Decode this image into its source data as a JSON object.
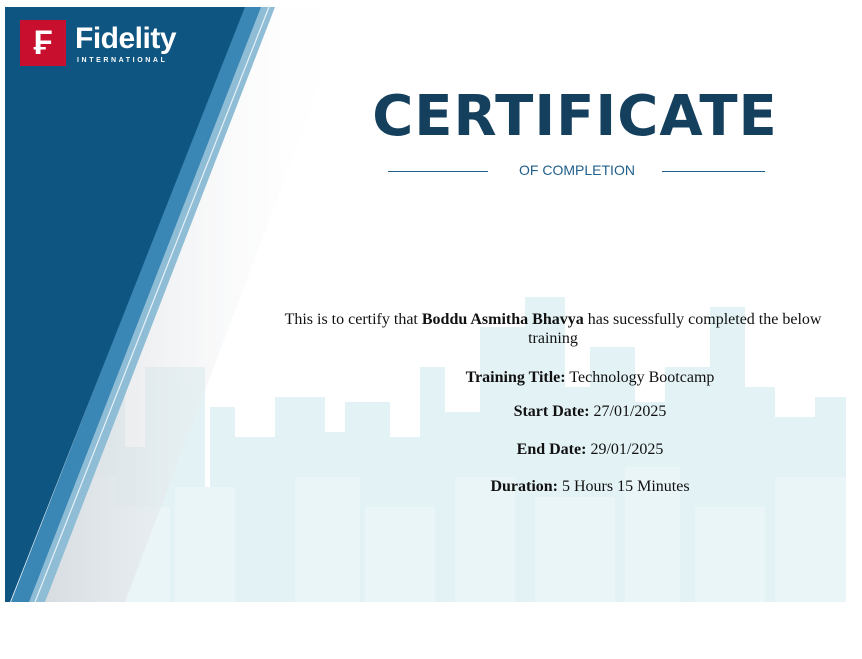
{
  "brand": {
    "logo_mark": "₣",
    "name": "Fidelity",
    "tagline": "INTERNATIONAL",
    "colors": {
      "navy": "#14405e",
      "blue_panel": "#0f5581",
      "red": "#c8102e",
      "accent": "#1f5f8b"
    }
  },
  "certificate": {
    "title": "CERTIFICATE",
    "subtitle": "OF COMPLETION",
    "intro_prefix": "This is to certify that",
    "recipient": "Boddu Asmitha Bhavya",
    "intro_suffix": "has sucessfully completed the below training"
  },
  "details": [
    {
      "label": "Training Title:",
      "value": "Technology Bootcamp"
    },
    {
      "label": "Start Date:",
      "value": "27/01/2025"
    },
    {
      "label": "End Date:",
      "value": "29/01/2025"
    },
    {
      "label": "Duration:",
      "value": "5 Hours 15 Minutes"
    }
  ]
}
